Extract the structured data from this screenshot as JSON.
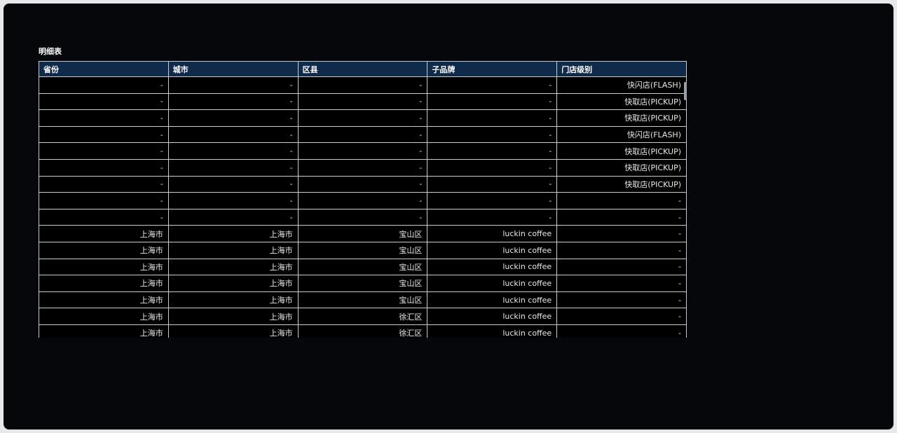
{
  "widget": {
    "title": "明细表"
  },
  "table": {
    "columns": [
      "省份",
      "城市",
      "区县",
      "子品牌",
      "门店级别"
    ],
    "rows": [
      [
        "-",
        "-",
        "-",
        "-",
        "快闪店(FLASH)"
      ],
      [
        "-",
        "-",
        "-",
        "-",
        "快取店(PICKUP)"
      ],
      [
        "-",
        "-",
        "-",
        "-",
        "快取店(PICKUP)"
      ],
      [
        "-",
        "-",
        "-",
        "-",
        "快闪店(FLASH)"
      ],
      [
        "-",
        "-",
        "-",
        "-",
        "快取店(PICKUP)"
      ],
      [
        "-",
        "-",
        "-",
        "-",
        "快取店(PICKUP)"
      ],
      [
        "-",
        "-",
        "-",
        "-",
        "快取店(PICKUP)"
      ],
      [
        "-",
        "-",
        "-",
        "-",
        "-"
      ],
      [
        "-",
        "-",
        "-",
        "-",
        "-"
      ],
      [
        "上海市",
        "上海市",
        "宝山区",
        "luckin coffee",
        "-"
      ],
      [
        "上海市",
        "上海市",
        "宝山区",
        "luckin coffee",
        "-"
      ],
      [
        "上海市",
        "上海市",
        "宝山区",
        "luckin coffee",
        "-"
      ],
      [
        "上海市",
        "上海市",
        "宝山区",
        "luckin coffee",
        "-"
      ],
      [
        "上海市",
        "上海市",
        "宝山区",
        "luckin coffee",
        "-"
      ],
      [
        "上海市",
        "上海市",
        "徐汇区",
        "luckin coffee",
        "-"
      ],
      [
        "上海市",
        "上海市",
        "徐汇区",
        "luckin coffee",
        "-"
      ]
    ]
  },
  "colors": {
    "background": "#05070b",
    "header": "#102b4a",
    "border": "#c8ccd2",
    "text": "#e6e8eb"
  }
}
